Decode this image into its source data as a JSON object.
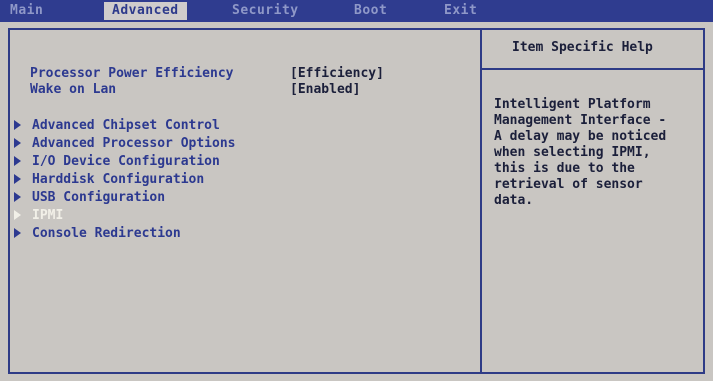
{
  "menu_bar": {
    "tabs": [
      "Main",
      "Advanced",
      "Security",
      "Boot",
      "Exit"
    ],
    "active_tab": "Advanced"
  },
  "settings": [
    {
      "label": "Processor Power Efficiency",
      "value": "[Efficiency]"
    },
    {
      "label": "Wake on Lan",
      "value": "[Enabled]"
    }
  ],
  "submenus": [
    "Advanced Chipset Control",
    "Advanced Processor Options",
    "I/O Device Configuration",
    "Harddisk Configuration",
    "USB Configuration",
    "IPMI",
    "Console Redirection"
  ],
  "selected_submenu": "IPMI",
  "help": {
    "title": "Item Specific Help",
    "lines": [
      "Intelligent Platform",
      "Management Interface -",
      "A delay may be noticed",
      "when selecting IPMI,",
      "this is due to the",
      "retrieval of sensor",
      "data."
    ]
  },
  "colors": {
    "background": "#c9c6c2",
    "menu_bar": "#2f3c8f",
    "accent_text": "#2c3990",
    "value_text": "#1b1f3a",
    "selected_text": "#f2f0e8"
  },
  "icons": {
    "submenu_marker": "triangle-right-icon"
  }
}
